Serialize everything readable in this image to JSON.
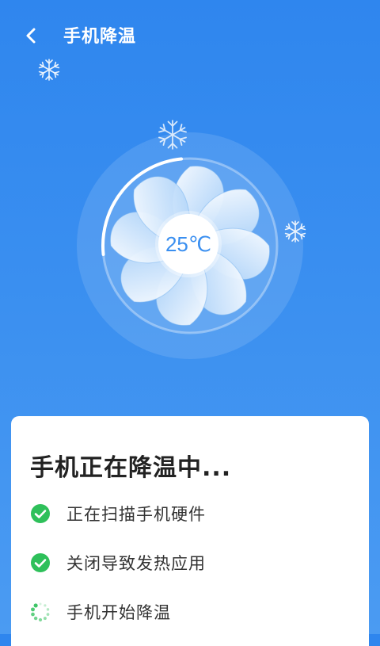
{
  "header": {
    "title": "手机降温",
    "back_icon": "chevron-left-icon"
  },
  "fan": {
    "temperature": "25℃",
    "progress_fraction": 0.25
  },
  "card": {
    "heading": "手机正在降温中...",
    "steps": [
      {
        "label": "正在扫描手机硬件",
        "status": "done",
        "icon": "check-circle-icon"
      },
      {
        "label": "关闭导致发热应用",
        "status": "done",
        "icon": "check-circle-icon"
      },
      {
        "label": "手机开始降温",
        "status": "in-progress",
        "icon": "loading-spinner-icon"
      }
    ]
  },
  "colors": {
    "background": "#2f86ee",
    "accent": "#3a8ff0",
    "success": "#2ec05a",
    "white": "#ffffff"
  }
}
